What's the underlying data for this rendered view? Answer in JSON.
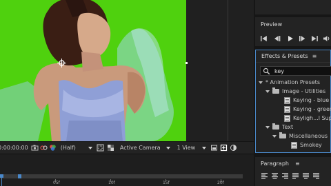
{
  "viewer": {
    "timecode": "0:00:00:00",
    "resolution": "(Half)",
    "camera": "Active Camera",
    "view_layout": "1 View"
  },
  "timeline": {
    "ticks": [
      "05f",
      "10f",
      "15f",
      "20f"
    ],
    "playhead_frame": 0
  },
  "panels": {
    "preview": {
      "title": "Preview"
    },
    "effects": {
      "title": "Effects & Presets",
      "menu_icon": "≡",
      "search_value": "key",
      "tree": [
        {
          "label": "* Animation Presets",
          "kind": "folder-root"
        },
        {
          "label": "Image - Utilities",
          "kind": "folder"
        },
        {
          "label": "Keying - blue b",
          "kind": "preset"
        },
        {
          "label": "Keying - green",
          "kind": "preset"
        },
        {
          "label": "Keyligh...l Supp",
          "kind": "preset"
        },
        {
          "label": "Text",
          "kind": "folder"
        },
        {
          "label": "Miscellaneous",
          "kind": "folder"
        },
        {
          "label": "Smokey",
          "kind": "preset"
        }
      ]
    },
    "paragraph": {
      "title": "Paragraph",
      "menu_icon": "≡"
    }
  },
  "colors": {
    "green_screen": "#4fd10e",
    "panel_bg": "#232323",
    "focus_border": "#4a88c9"
  },
  "icons": [
    "anchor-point-icon",
    "snapshot-icon",
    "show-snapshot-icon",
    "color-channel-icon",
    "region-of-interest-icon",
    "transparency-grid-icon",
    "play-icon",
    "search-icon",
    "align-left-icon"
  ]
}
